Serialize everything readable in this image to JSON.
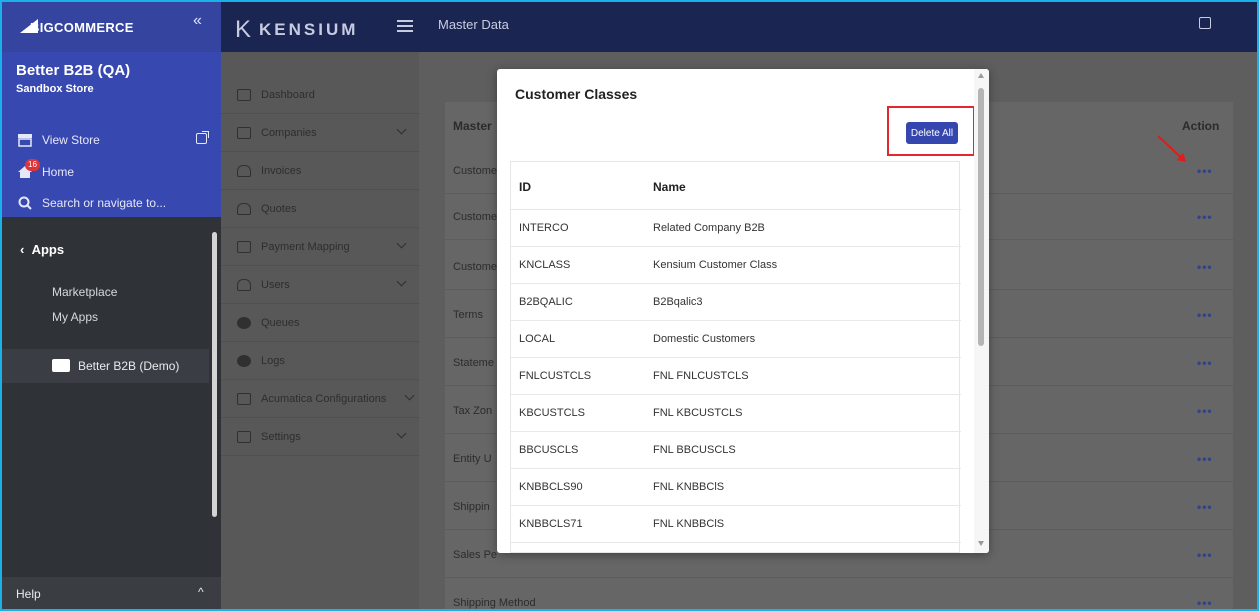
{
  "bigcommerce": {
    "logo": "BIGCOMMERCE",
    "collapse": "«",
    "store_name": "Better B2B (QA)",
    "store_sub": "Sandbox Store",
    "view_store": "View Store",
    "home": "Home",
    "home_badge": "16",
    "search": "Search or navigate to...",
    "apps": "Apps",
    "marketplace": "Marketplace",
    "my_apps": "My Apps",
    "selected_app": "Better B2B (Demo)",
    "help": "Help"
  },
  "kensium": {
    "logo": "KENSIUM",
    "page_title": "Master Data",
    "nav": [
      {
        "label": "Dashboard",
        "icon": "dashboard-icon"
      },
      {
        "label": "Companies",
        "icon": "building-icon",
        "expandable": true
      },
      {
        "label": "Invoices",
        "icon": "person-icon"
      },
      {
        "label": "Quotes",
        "icon": "person-icon"
      },
      {
        "label": "Payment Mapping",
        "icon": "building-icon",
        "expandable": true
      },
      {
        "label": "Users",
        "icon": "person-icon",
        "expandable": true
      },
      {
        "label": "Queues",
        "icon": "circle-icon"
      },
      {
        "label": "Logs",
        "icon": "circle-icon"
      },
      {
        "label": "Acumatica Configurations",
        "icon": "gear-box-icon",
        "expandable": true
      },
      {
        "label": "Settings",
        "icon": "gear-box-icon",
        "expandable": true
      }
    ],
    "table": {
      "col_master": "Master",
      "col_action": "Action",
      "rows": [
        "Custome",
        "Custome",
        "Custome",
        "Terms",
        "Stateme",
        "Tax Zon",
        "Entity U",
        "Shippin",
        "Sales Pe",
        "Shipping Method"
      ],
      "action_label": "•••"
    }
  },
  "modal": {
    "title": "Customer Classes",
    "delete_all": "Delete All",
    "columns": [
      "ID",
      "Name"
    ],
    "rows": [
      {
        "id": "INTERCO",
        "name": "Related Company B2B"
      },
      {
        "id": "KNCLASS",
        "name": "Kensium Customer Class"
      },
      {
        "id": "B2BQALIC",
        "name": "B2Bqalic3"
      },
      {
        "id": "LOCAL",
        "name": "Domestic Customers"
      },
      {
        "id": "FNLCUSTCLS",
        "name": "FNL FNLCUSTCLS"
      },
      {
        "id": "KBCUSTCLS",
        "name": "FNL KBCUSTCLS"
      },
      {
        "id": "BBCUSCLS",
        "name": "FNL BBCUSCLS"
      },
      {
        "id": "KNBBCLS90",
        "name": "FNL KNBBClS"
      },
      {
        "id": "KNBBCLS71",
        "name": "FNL KNBBClS"
      }
    ]
  }
}
